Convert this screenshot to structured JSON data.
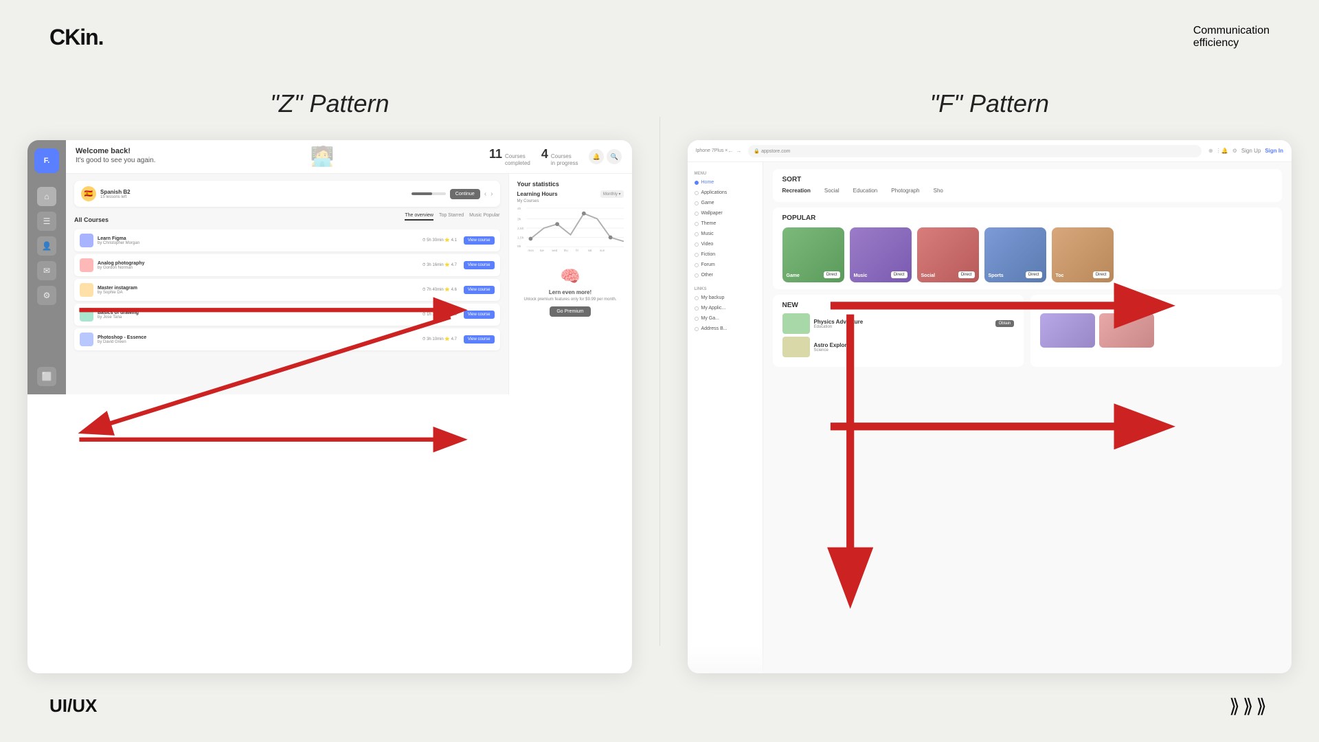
{
  "header": {
    "logo": "CKin.",
    "subtitle_line1": "Communication",
    "subtitle_line2": "efficiency"
  },
  "footer": {
    "label": "UI/UX",
    "arrows": ">>>"
  },
  "z_panel": {
    "title": "\"Z\" Pattern",
    "mockup": {
      "sidebar_logo": "F.",
      "greeting": "It's good to see you again.",
      "stats": [
        {
          "num": "11",
          "label": "Courses\ncompleted"
        },
        {
          "num": "4",
          "label": "Courses\nin progress"
        }
      ],
      "statistics_title": "Your statistics",
      "learning_hours_title": "Learning Hours",
      "filter": "Monthly",
      "tabs": [
        "All Courses",
        "The overview",
        "Top Starred",
        "Music Popular"
      ],
      "courses": [
        {
          "name": "Learn Figma",
          "author": "by Christopher Morgan",
          "color": "#a8b4ff",
          "rating": "4.1"
        },
        {
          "name": "Analog photography",
          "author": "by Gordon Norman",
          "color": "#ffb8b8",
          "rating": "4.7"
        },
        {
          "name": "Master instagram",
          "author": "by Sophie DA",
          "color": "#ffe0a8",
          "rating": "4.6"
        },
        {
          "name": "Basics of drawing",
          "author": "by Jose Tana",
          "color": "#a8e6cf",
          "rating": "4.3"
        },
        {
          "name": "Photoshop - Essence",
          "author": "by David Green",
          "color": "#b8c8ff",
          "rating": "4.7"
        }
      ],
      "premium_title": "Lern even more!",
      "premium_sub": "Unlock premium features only for $9.99 per month.",
      "premium_btn": "Go Premium",
      "current_course": "Spanish B2",
      "continue_btn": "Continue"
    }
  },
  "f_panel": {
    "title": "\"F\" Pattern",
    "mockup": {
      "device_label": "Iphone 7Plus ×",
      "url": "appstore.com",
      "signup": "Sign Up",
      "signin": "Sign In",
      "sidebar_sections": [
        {
          "label": "MENU",
          "items": [
            {
              "name": "Home",
              "active": true
            },
            {
              "name": "Applications",
              "active": false
            },
            {
              "name": "Game",
              "active": false
            },
            {
              "name": "Wallpaper",
              "active": false
            },
            {
              "name": "Theme",
              "active": false
            },
            {
              "name": "Music",
              "active": false
            },
            {
              "name": "Video",
              "active": false
            },
            {
              "name": "Fiction",
              "active": false
            },
            {
              "name": "Forum",
              "active": false
            },
            {
              "name": "Other",
              "active": false
            }
          ]
        },
        {
          "label": "LINKS",
          "items": [
            {
              "name": "My backup",
              "active": false
            },
            {
              "name": "My Applications",
              "active": false
            },
            {
              "name": "My Games",
              "active": false
            },
            {
              "name": "Address Book",
              "active": false
            }
          ]
        }
      ],
      "sort_title": "SORT",
      "sort_tabs": [
        "Recreation",
        "Social",
        "Education",
        "Photograph",
        "Sho"
      ],
      "popular_title": "POPULAR",
      "popular_cards": [
        {
          "label": "Game",
          "color": "#7cba7c"
        },
        {
          "label": "Music",
          "color": "#9b7cc8"
        },
        {
          "label": "Social",
          "color": "#d87c7c"
        },
        {
          "label": "Sports",
          "color": "#7c9bd8"
        },
        {
          "label": "Toc",
          "color": "#d8a87c"
        }
      ],
      "new_title": "NEW",
      "topic_title": "TOPIC",
      "new_items": [
        {
          "name": "Physics Adventure",
          "badge": "Obtain"
        },
        {
          "name": "..."
        }
      ]
    }
  }
}
